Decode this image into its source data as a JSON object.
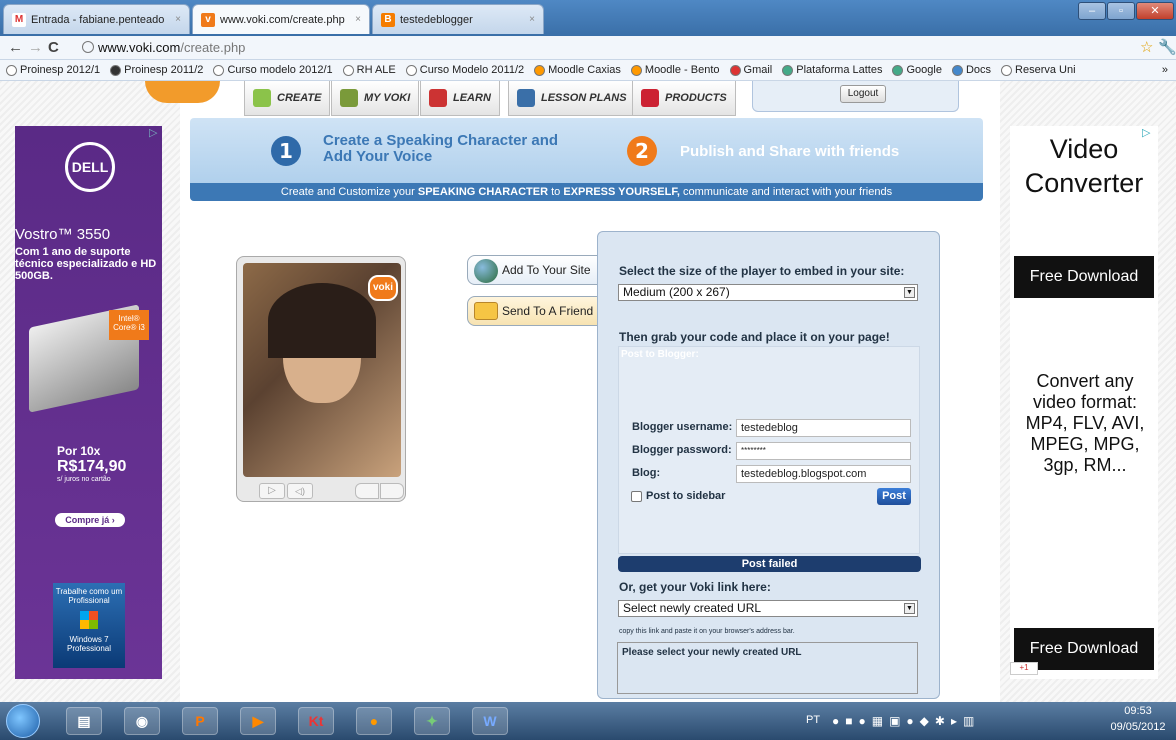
{
  "browser": {
    "tabs": [
      {
        "label": "Entrada - fabiane.penteado",
        "close": "×"
      },
      {
        "label": "www.voki.com/create.php",
        "close": "×"
      },
      {
        "label": "testedeblogger",
        "close": "×"
      }
    ],
    "url_host": "www.voki.com",
    "url_path": "/create.php",
    "bookmarks": [
      "Proinesp 2012/1",
      "Proinesp 2011/2",
      "Curso modelo 2012/1",
      "RH ALE",
      "Curso Modelo 2011/2",
      "Moodle Caxias",
      "Moodle - Bento",
      "Gmail",
      "Plataforma Lattes",
      "Google",
      "Docs",
      "Reserva Uni"
    ],
    "more": "»"
  },
  "site": {
    "nav": [
      "CREATE",
      "MY VOKI",
      "LEARN",
      "LESSON PLANS",
      "PRODUCTS"
    ],
    "logout": "Logout",
    "step1_num": "1",
    "step1_text": "Create a Speaking Character and Add Your Voice",
    "step2_num": "2",
    "step2_text": "Publish and Share with friends",
    "strip_pre": "Create and Customize your ",
    "strip_b1": "SPEAKING CHARACTER",
    "strip_mid": " to ",
    "strip_b2": "EXPRESS YOURSELF,",
    "strip_post": " communicate and interact with your friends"
  },
  "player": {
    "logo": "voki"
  },
  "side_buttons": {
    "add": "Add To Your Site",
    "send": "Send To A Friend"
  },
  "embed": {
    "size_label": "Select the size of the player to embed in your site:",
    "size_value": "Medium (200 x 267)",
    "grab_label": "Then grab your code and place it on your page!",
    "post_to": "Post to Blogger:",
    "user_label": "Blogger username:",
    "user_value": "testedeblog",
    "pass_label": "Blogger password:",
    "pass_value": "********",
    "blog_label": "Blog:",
    "blog_value": "testedeblog.blogspot.com",
    "sidebar_label": "Post to sidebar",
    "post_btn": "Post",
    "status": "Post failed",
    "link_label": "Or, get your Voki link here:",
    "link_value": "Select newly created URL",
    "copy_hint": "copy this link and paste it on your browser's address bar.",
    "textarea": "Please select your newly created URL"
  },
  "left_ad": {
    "brand": "DELL",
    "model": "Vostro™ 3550",
    "desc": "Com 1 ano de suporte técnico especializado e HD 500GB.",
    "chip": "Intel® Core® i3",
    "price_prefix": "Por 10x",
    "price": "R$174,90",
    "price_note": "s/ juros no cartão",
    "cta": "Compre já ›",
    "win_text": "Trabalhe como um Profissional",
    "win_logo": "Windows 7 Professional"
  },
  "right_ad": {
    "title": "Video Converter",
    "btn1": "Free Download",
    "body": "Convert any video format: MP4, FLV, AVI, MPEG, MPG, 3gp, RM...",
    "btn2": "Free Download",
    "plus": "+1"
  },
  "taskbar": {
    "lang": "PT",
    "time": "09:53",
    "date": "09/05/2012",
    "apps": [
      "start",
      "explorer",
      "chrome",
      "powerpoint",
      "player",
      "kt",
      "firefox",
      "messenger",
      "word"
    ]
  },
  "colors": {
    "accent": "#3c78b5",
    "orange": "#f07a1a",
    "panel": "#dbe6f2",
    "status_bar": "#1d3d6e"
  }
}
